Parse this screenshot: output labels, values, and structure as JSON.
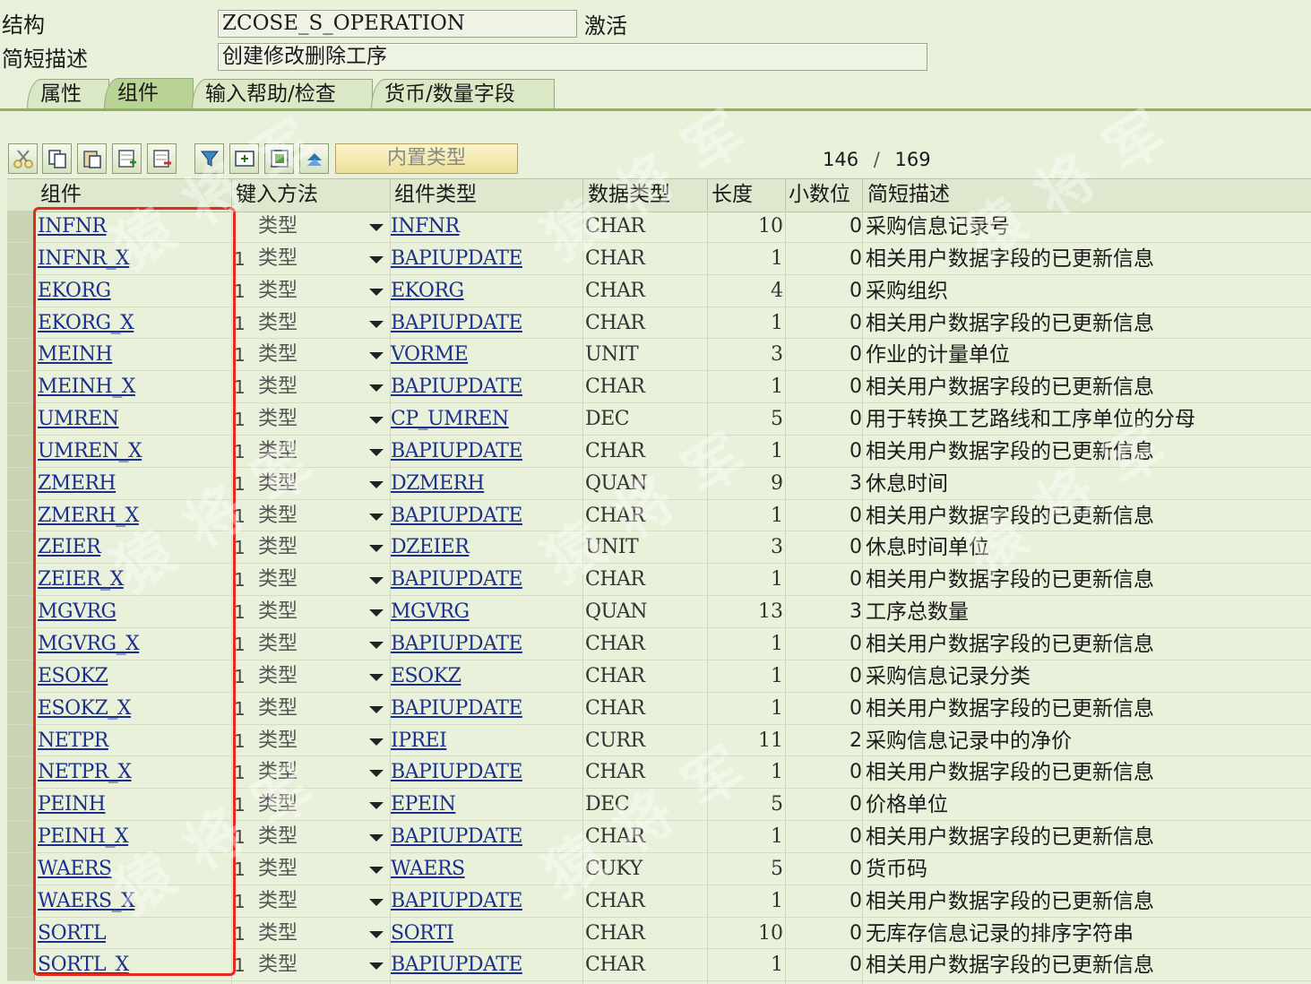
{
  "header": {
    "structure_label": "结构",
    "structure_value": "ZCOSE_S_OPERATION",
    "status": "激活",
    "desc_label": "简短描述",
    "desc_value": "创建修改删除工序"
  },
  "tabs": [
    {
      "label": "属性",
      "active": false
    },
    {
      "label": "组件",
      "active": true
    },
    {
      "label": "输入帮助/检查",
      "active": false
    },
    {
      "label": "货币/数量字段",
      "active": false
    }
  ],
  "toolbar": {
    "icons": [
      "cut-icon",
      "copy-icon",
      "paste-icon",
      "insert-row-icon",
      "delete-row-icon",
      "filter-icon",
      "add-field-icon",
      "append-structure-icon",
      "sort-icon"
    ],
    "builtin_type_label": "内置类型",
    "counter_current": "146",
    "counter_sep": "/",
    "counter_total": "169"
  },
  "columns": [
    "组件",
    "键入方法",
    "组件类型",
    "数据类型",
    "长度",
    "小数位",
    "简短描述"
  ],
  "rows": [
    {
      "comp": "INFNR",
      "one": "",
      "method": "类型",
      "type": "INFNR",
      "data": "CHAR",
      "len": "10",
      "dec": "0",
      "desc": "采购信息记录号"
    },
    {
      "comp": "INFNR_X",
      "one": "1",
      "method": "类型",
      "type": "BAPIUPDATE",
      "data": "CHAR",
      "len": "1",
      "dec": "0",
      "desc": "相关用户数据字段的已更新信息"
    },
    {
      "comp": "EKORG",
      "one": "1",
      "method": "类型",
      "type": "EKORG",
      "data": "CHAR",
      "len": "4",
      "dec": "0",
      "desc": "采购组织"
    },
    {
      "comp": "EKORG_X",
      "one": "1",
      "method": "类型",
      "type": "BAPIUPDATE",
      "data": "CHAR",
      "len": "1",
      "dec": "0",
      "desc": "相关用户数据字段的已更新信息"
    },
    {
      "comp": "MEINH",
      "one": "1",
      "method": "类型",
      "type": "VORME",
      "data": "UNIT",
      "len": "3",
      "dec": "0",
      "desc": "作业的计量单位"
    },
    {
      "comp": "MEINH_X",
      "one": "1",
      "method": "类型",
      "type": "BAPIUPDATE",
      "data": "CHAR",
      "len": "1",
      "dec": "0",
      "desc": "相关用户数据字段的已更新信息"
    },
    {
      "comp": "UMREN",
      "one": "1",
      "method": "类型",
      "type": "CP_UMREN",
      "data": "DEC",
      "len": "5",
      "dec": "0",
      "desc": "用于转换工艺路线和工序单位的分母"
    },
    {
      "comp": "UMREN_X",
      "one": "1",
      "method": "类型",
      "type": "BAPIUPDATE",
      "data": "CHAR",
      "len": "1",
      "dec": "0",
      "desc": "相关用户数据字段的已更新信息"
    },
    {
      "comp": "ZMERH",
      "one": "1",
      "method": "类型",
      "type": "DZMERH",
      "data": "QUAN",
      "len": "9",
      "dec": "3",
      "desc": "休息时间"
    },
    {
      "comp": "ZMERH_X",
      "one": "1",
      "method": "类型",
      "type": "BAPIUPDATE",
      "data": "CHAR",
      "len": "1",
      "dec": "0",
      "desc": "相关用户数据字段的已更新信息"
    },
    {
      "comp": "ZEIER",
      "one": "1",
      "method": "类型",
      "type": "DZEIER",
      "data": "UNIT",
      "len": "3",
      "dec": "0",
      "desc": "休息时间单位"
    },
    {
      "comp": "ZEIER_X",
      "one": "1",
      "method": "类型",
      "type": "BAPIUPDATE",
      "data": "CHAR",
      "len": "1",
      "dec": "0",
      "desc": "相关用户数据字段的已更新信息"
    },
    {
      "comp": "MGVRG",
      "one": "1",
      "method": "类型",
      "type": "MGVRG",
      "data": "QUAN",
      "len": "13",
      "dec": "3",
      "desc": "工序总数量"
    },
    {
      "comp": "MGVRG_X",
      "one": "1",
      "method": "类型",
      "type": "BAPIUPDATE",
      "data": "CHAR",
      "len": "1",
      "dec": "0",
      "desc": "相关用户数据字段的已更新信息"
    },
    {
      "comp": "ESOKZ",
      "one": "1",
      "method": "类型",
      "type": "ESOKZ",
      "data": "CHAR",
      "len": "1",
      "dec": "0",
      "desc": "采购信息记录分类"
    },
    {
      "comp": "ESOKZ_X",
      "one": "1",
      "method": "类型",
      "type": "BAPIUPDATE",
      "data": "CHAR",
      "len": "1",
      "dec": "0",
      "desc": "相关用户数据字段的已更新信息"
    },
    {
      "comp": "NETPR",
      "one": "1",
      "method": "类型",
      "type": "IPREI",
      "data": "CURR",
      "len": "11",
      "dec": "2",
      "desc": "采购信息记录中的净价"
    },
    {
      "comp": "NETPR_X",
      "one": "1",
      "method": "类型",
      "type": "BAPIUPDATE",
      "data": "CHAR",
      "len": "1",
      "dec": "0",
      "desc": "相关用户数据字段的已更新信息"
    },
    {
      "comp": "PEINH",
      "one": "1",
      "method": "类型",
      "type": "EPEIN",
      "data": "DEC",
      "len": "5",
      "dec": "0",
      "desc": "价格单位"
    },
    {
      "comp": "PEINH_X",
      "one": "1",
      "method": "类型",
      "type": "BAPIUPDATE",
      "data": "CHAR",
      "len": "1",
      "dec": "0",
      "desc": "相关用户数据字段的已更新信息"
    },
    {
      "comp": "WAERS",
      "one": "1",
      "method": "类型",
      "type": "WAERS",
      "data": "CUKY",
      "len": "5",
      "dec": "0",
      "desc": "货币码"
    },
    {
      "comp": "WAERS_X",
      "one": "1",
      "method": "类型",
      "type": "BAPIUPDATE",
      "data": "CHAR",
      "len": "1",
      "dec": "0",
      "desc": "相关用户数据字段的已更新信息"
    },
    {
      "comp": "SORTL",
      "one": "1",
      "method": "类型",
      "type": "SORTI",
      "data": "CHAR",
      "len": "10",
      "dec": "0",
      "desc": "无库存信息记录的排序字符串"
    },
    {
      "comp": "SORTL_X",
      "one": "1",
      "method": "类型",
      "type": "BAPIUPDATE",
      "data": "CHAR",
      "len": "1",
      "dec": "0",
      "desc": "相关用户数据字段的已更新信息"
    }
  ],
  "watermark": "猿将军",
  "colors": {
    "background": "#e9f1da",
    "link": "#1b2f8c",
    "highlight": "#e8281e",
    "tab_active": "#b9d394"
  }
}
